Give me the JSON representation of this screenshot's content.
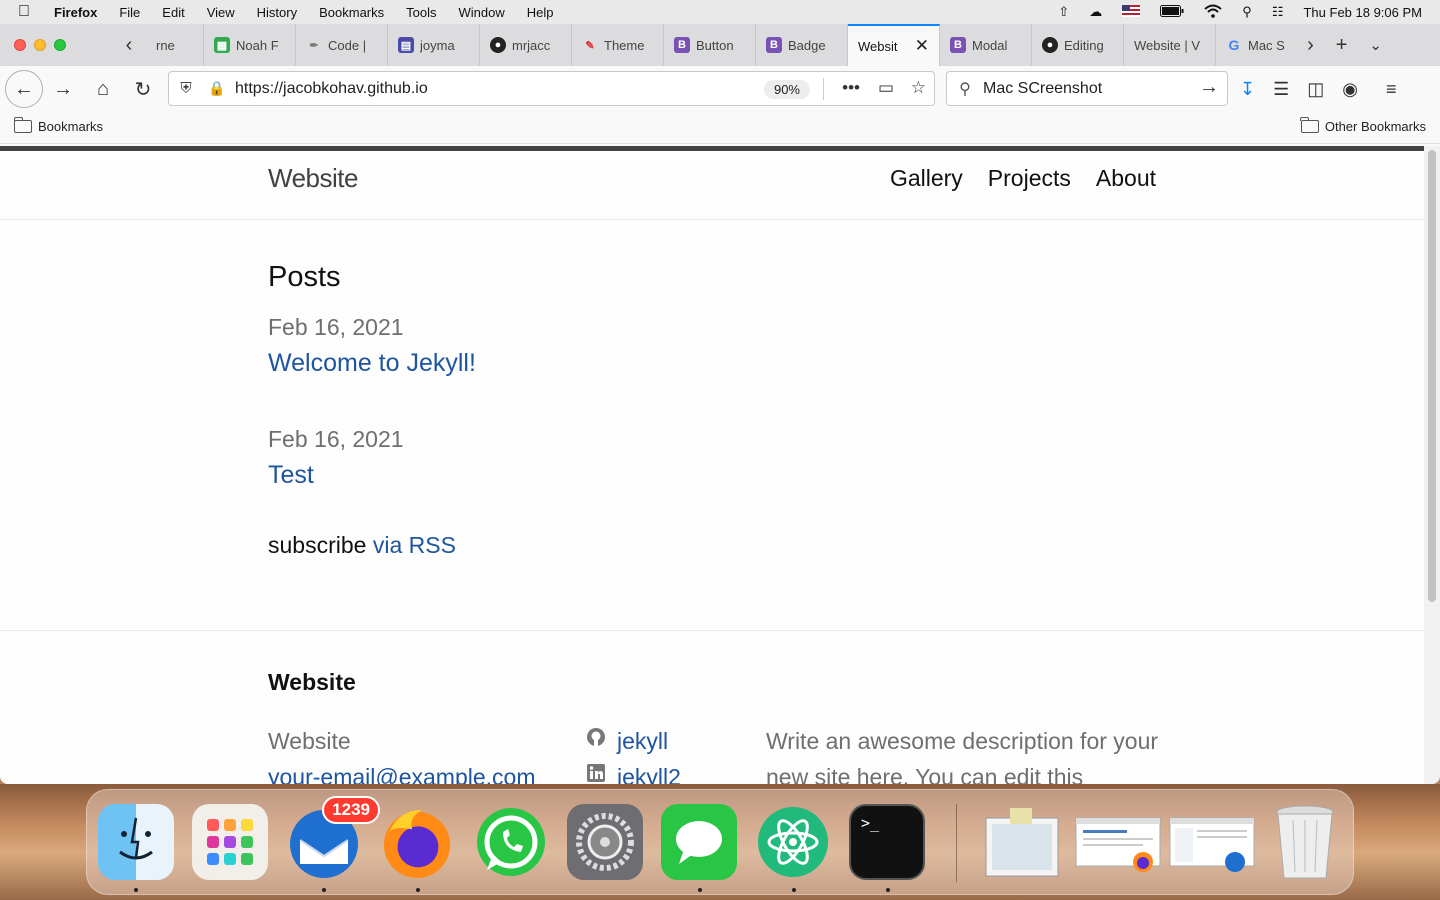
{
  "menubar": {
    "app_name": "Firefox",
    "menus": [
      "File",
      "Edit",
      "View",
      "History",
      "Bookmarks",
      "Tools",
      "Window",
      "Help"
    ],
    "datetime": "Thu Feb 18  9:06 PM"
  },
  "tabs": [
    {
      "label": "rne",
      "favicon": "globe-icon",
      "active": false
    },
    {
      "label": "Noah F",
      "favicon": "sheet-icon",
      "active": false
    },
    {
      "label": "Code |",
      "favicon": "pen-icon",
      "active": false
    },
    {
      "label": "joyma",
      "favicon": "site-icon",
      "active": false
    },
    {
      "label": "mrjacc",
      "favicon": "github-icon",
      "active": false
    },
    {
      "label": "Theme",
      "favicon": "brush-icon",
      "active": false
    },
    {
      "label": "Button",
      "favicon": "bootstrap-icon",
      "active": false
    },
    {
      "label": "Badge",
      "favicon": "bootstrap-icon",
      "active": false
    },
    {
      "label": "Websit",
      "favicon": "",
      "active": true
    },
    {
      "label": "Modal",
      "favicon": "bootstrap-icon",
      "active": false
    },
    {
      "label": "Editing",
      "favicon": "github-icon",
      "active": false
    },
    {
      "label": "Website | V",
      "favicon": "",
      "active": false
    },
    {
      "label": "Mac S",
      "favicon": "google-icon",
      "active": false
    }
  ],
  "toolbar": {
    "url": "https://jacobkohav.github.io",
    "zoom": "90%",
    "search_value": "Mac SCreenshot"
  },
  "bookmarks": {
    "left": "Bookmarks",
    "right": "Other Bookmarks"
  },
  "site": {
    "title": "Website",
    "nav": [
      "Gallery",
      "Projects",
      "About"
    ],
    "heading": "Posts",
    "posts": [
      {
        "date": "Feb 16, 2021",
        "title": "Welcome to Jekyll!"
      },
      {
        "date": "Feb 16, 2021",
        "title": "Test"
      }
    ],
    "subscribe_text": "subscribe",
    "subscribe_link": "via RSS",
    "footer": {
      "heading": "Website",
      "name": "Website",
      "email": "your-email@example.com",
      "social": [
        {
          "icon": "github-icon",
          "label": "jekyll"
        },
        {
          "icon": "linkedin-icon",
          "label": "jekyll2"
        }
      ],
      "description": "Write an awesome description for your new site here. You can edit this"
    }
  },
  "dock": {
    "mail_badge": "1239",
    "apps": [
      "Finder",
      "Launchpad",
      "Thunderbird",
      "Firefox",
      "WhatsApp",
      "System Preferences",
      "Messages",
      "Atom",
      "Terminal",
      "Preview",
      "Firefox Window",
      "Thunderbird Window",
      "Trash"
    ]
  },
  "colors": {
    "link": "#1f55a0",
    "tab_accent": "#0a84ff",
    "header_border": "#424242"
  }
}
